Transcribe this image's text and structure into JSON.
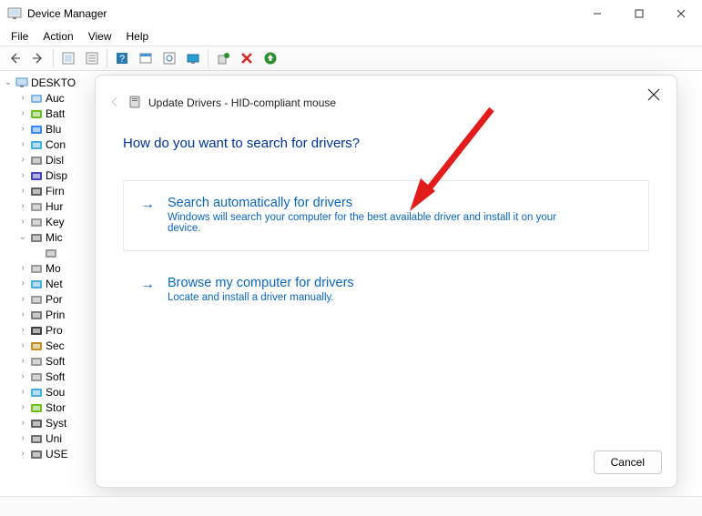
{
  "window": {
    "title": "Device Manager"
  },
  "menus": [
    "File",
    "Action",
    "View",
    "Help"
  ],
  "tree": {
    "root": "DESKTO",
    "nodes": [
      {
        "label": "Auc",
        "expandable": true,
        "iconColor": "#6fa8dc"
      },
      {
        "label": "Batt",
        "expandable": true,
        "iconColor": "#59b300"
      },
      {
        "label": "Blu",
        "expandable": true,
        "iconColor": "#1a73e8"
      },
      {
        "label": "Con",
        "expandable": true,
        "iconColor": "#2a9fd6"
      },
      {
        "label": "Disl",
        "expandable": true,
        "iconColor": "#777"
      },
      {
        "label": "Disp",
        "expandable": true,
        "iconColor": "#2222aa"
      },
      {
        "label": "Firn",
        "expandable": true,
        "iconColor": "#444"
      },
      {
        "label": "Hur",
        "expandable": true,
        "iconColor": "#888"
      },
      {
        "label": "Key",
        "expandable": true,
        "iconColor": "#888"
      },
      {
        "label": "Mic",
        "expandable": true,
        "expanded": true,
        "iconColor": "#666"
      },
      {
        "label": "",
        "child": true,
        "iconColor": "#888"
      },
      {
        "label": "Mo",
        "expandable": true,
        "iconColor": "#888"
      },
      {
        "label": "Net",
        "expandable": true,
        "iconColor": "#2a9fd6"
      },
      {
        "label": "Por",
        "expandable": true,
        "iconColor": "#888"
      },
      {
        "label": "Prin",
        "expandable": true,
        "iconColor": "#666"
      },
      {
        "label": "Pro",
        "expandable": true,
        "iconColor": "#222"
      },
      {
        "label": "Sec",
        "expandable": true,
        "iconColor": "#b07d00"
      },
      {
        "label": "Soft",
        "expandable": true,
        "iconColor": "#888"
      },
      {
        "label": "Soft",
        "expandable": true,
        "iconColor": "#888"
      },
      {
        "label": "Sou",
        "expandable": true,
        "iconColor": "#2a9fd6"
      },
      {
        "label": "Stor",
        "expandable": true,
        "iconColor": "#59b300"
      },
      {
        "label": "Syst",
        "expandable": true,
        "iconColor": "#444"
      },
      {
        "label": "Uni",
        "expandable": true,
        "iconColor": "#555"
      },
      {
        "label": "USE",
        "expandable": true,
        "iconColor": "#555"
      }
    ]
  },
  "dialog": {
    "title": "Update Drivers - HID-compliant mouse",
    "question": "How do you want to search for drivers?",
    "options": [
      {
        "title": "Search automatically for drivers",
        "desc": "Windows will search your computer for the best available driver and install it on your device."
      },
      {
        "title": "Browse my computer for drivers",
        "desc": "Locate and install a driver manually."
      }
    ],
    "cancel": "Cancel"
  }
}
